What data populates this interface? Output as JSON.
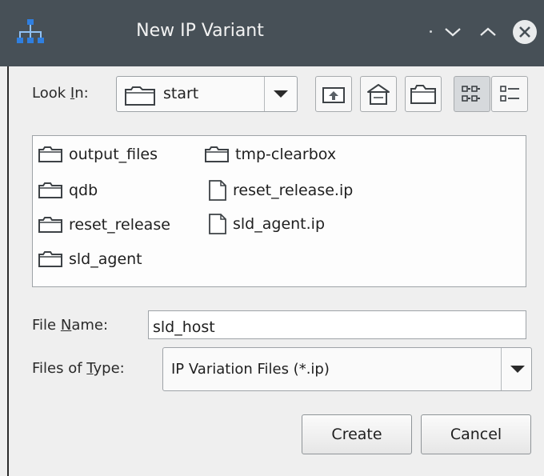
{
  "window": {
    "title": "New IP Variant",
    "controls": {
      "minimize": "chevron-down-icon",
      "maximize": "chevron-up-icon",
      "close": "close-icon"
    }
  },
  "look_in": {
    "label_pre": "Look ",
    "label_mnemonic": "I",
    "label_post": "n:",
    "selected": "start"
  },
  "toolbar": [
    "up-one-level-icon",
    "home-icon",
    "new-folder-icon",
    "list-view-icon",
    "details-view-icon"
  ],
  "files": [
    {
      "name": "output_files",
      "type": "folder"
    },
    {
      "name": "qdb",
      "type": "folder"
    },
    {
      "name": "reset_release",
      "type": "folder"
    },
    {
      "name": "sld_agent",
      "type": "folder"
    },
    {
      "name": "tmp-clearbox",
      "type": "folder"
    },
    {
      "name": "reset_release.ip",
      "type": "file"
    },
    {
      "name": "sld_agent.ip",
      "type": "file"
    }
  ],
  "file_name": {
    "label_pre": "File ",
    "label_mnemonic": "N",
    "label_post": "ame:",
    "value": "sld_host"
  },
  "files_of_type": {
    "label_pre": "Files of ",
    "label_mnemonic": "T",
    "label_post": "ype:",
    "selected": "IP Variation Files (*.ip)"
  },
  "buttons": {
    "create": "Create",
    "cancel": "Cancel"
  },
  "colors": {
    "titlebar": "#475057",
    "dialog_bg": "#efefef",
    "list_bg": "#fdfdfd"
  }
}
